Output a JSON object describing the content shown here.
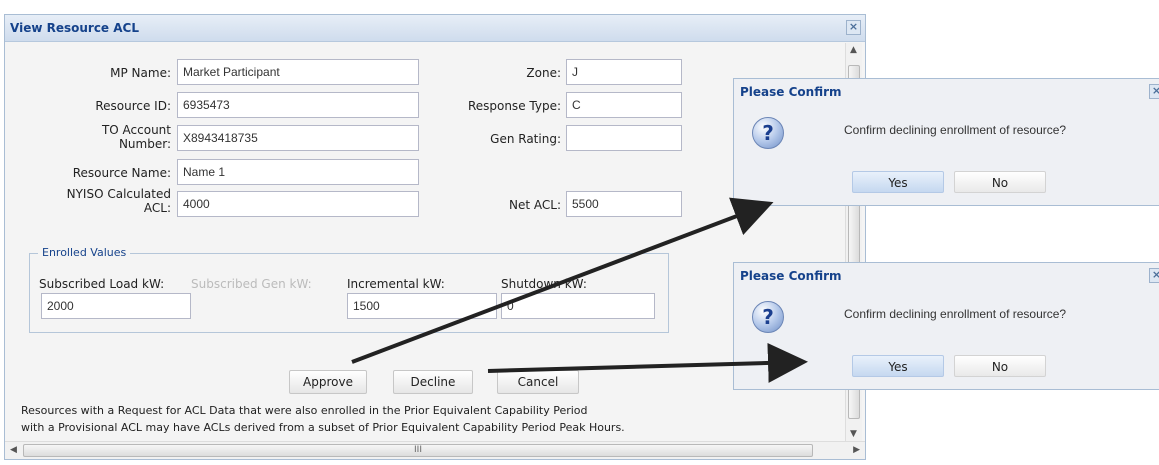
{
  "window": {
    "title": "View Resource ACL"
  },
  "form": {
    "mp_name_label": "MP Name:",
    "mp_name": "Market Participant",
    "zone_label": "Zone:",
    "zone": "J",
    "resource_id_label": "Resource ID:",
    "resource_id": "6935473",
    "response_type_label": "Response Type:",
    "response_type": "C",
    "to_account_label_1": "TO Account",
    "to_account_label_2": "Number:",
    "to_account": "X8943418735",
    "gen_rating_label": "Gen Rating:",
    "gen_rating": "",
    "resource_name_label": "Resource Name:",
    "resource_name": "Name 1",
    "nyiso_acl_label_1": "NYISO Calculated",
    "nyiso_acl_label_2": "ACL:",
    "nyiso_acl": "4000",
    "net_acl_label": "Net ACL:",
    "net_acl": "5500"
  },
  "enrolled": {
    "legend": "Enrolled Values",
    "subscribed_load_label": "Subscribed Load kW:",
    "subscribed_load": "2000",
    "subscribed_gen_label": "Subscribed Gen kW:",
    "incremental_label": "Incremental kW:",
    "incremental": "1500",
    "shutdown_label": "Shutdown kW:",
    "shutdown": "0"
  },
  "buttons": {
    "approve": "Approve",
    "decline": "Decline",
    "cancel": "Cancel"
  },
  "note": {
    "line1": "Resources with a Request for ACL Data that were also enrolled in the Prior Equivalent Capability Period",
    "line2": "with a Provisional ACL may have ACLs derived from a subset of Prior Equivalent Capability Period Peak Hours."
  },
  "scrollbar": {
    "grip": "III"
  },
  "confirm_dialogs": [
    {
      "title": "Please Confirm",
      "message": "Confirm declining enrollment of resource?",
      "yes": "Yes",
      "no": "No"
    },
    {
      "title": "Please Confirm",
      "message": "Confirm declining enrollment of resource?",
      "yes": "Yes",
      "no": "No"
    }
  ],
  "icons": {
    "close": "close-icon",
    "question": "question-icon",
    "arrow": "annotation-arrow"
  },
  "colors": {
    "title_text": "#15428b",
    "arrow": "#222222"
  }
}
